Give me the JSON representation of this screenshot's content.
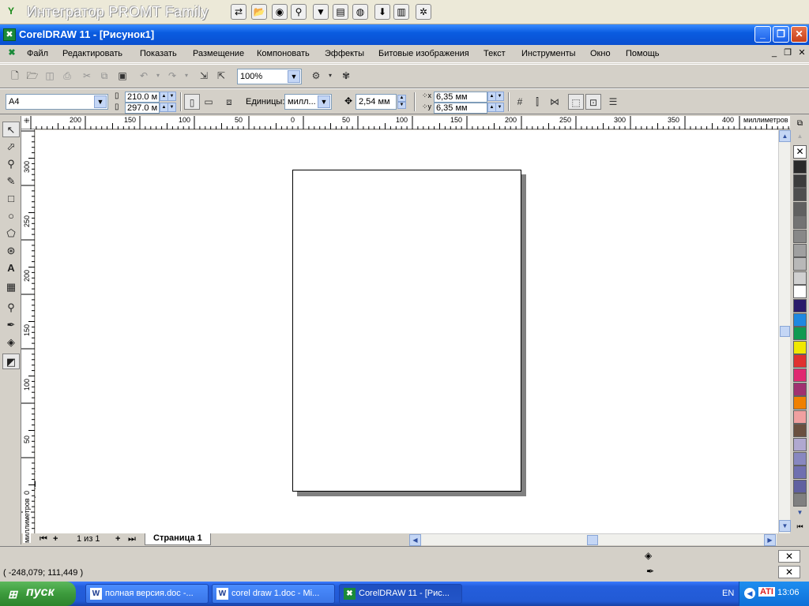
{
  "promt": {
    "title": "Интегратор PROMT Family",
    "icons": [
      "promt-logo-icon",
      "translate-icon",
      "open-folder-icon",
      "web-translate-icon",
      "dictionary-icon",
      "filter-icon",
      "book-icon",
      "globe-icon",
      "download-icon",
      "book-open-icon",
      "settings-icon"
    ]
  },
  "window": {
    "title": "CorelDRAW 11 - [Рисунок1]",
    "minimize": "_",
    "maximize": "❐",
    "close": "✕"
  },
  "menu": {
    "items": [
      "Файл",
      "Редактировать",
      "Показать",
      "Размещение",
      "Компоновать",
      "Эффекты",
      "Битовые изображения",
      "Текст",
      "Инструменты",
      "Окно",
      "Помощь"
    ]
  },
  "standard_toolbar": {
    "zoom": "100%"
  },
  "property_bar": {
    "paper_size": "A4",
    "width": "210.0 м",
    "height": "297.0 м",
    "units_label": "Единицы:",
    "units_value": "милл...",
    "nudge": "2,54 мм",
    "dup_x": "6,35 мм",
    "dup_y": "6,35 мм"
  },
  "rulers": {
    "unit_label": "миллиметров",
    "h_ticks": [
      "200",
      "150",
      "100",
      "50",
      "0",
      "50",
      "100",
      "150",
      "200",
      "250",
      "300",
      "350",
      "400"
    ],
    "v_ticks": [
      "300",
      "250",
      "200",
      "150",
      "100",
      "50",
      "0"
    ]
  },
  "page_tabs": {
    "counter": "1 из 1",
    "tab": "Страница 1"
  },
  "palette": {
    "colors": [
      "#2a2a2a",
      "#3c3c3c",
      "#4e4e4e",
      "#606060",
      "#737373",
      "#888888",
      "#a0a0a0",
      "#b8b8b8",
      "#d0d0d0",
      "#ffffff",
      "#2a1a6a",
      "#1e88e0",
      "#109a50",
      "#f0e800",
      "#e03030",
      "#e02870",
      "#a03070",
      "#f08000",
      "#f0a0a0",
      "#6a5040",
      "#b0a8d0",
      "#8888c0",
      "#7070b0",
      "#6060a0",
      "#808080"
    ]
  },
  "status": {
    "coords": "( -248,079; 111,449 )"
  },
  "taskbar": {
    "start": "пуск",
    "tasks": [
      "полная версия.doc -...",
      "corel draw 1.doc - Mi...",
      "CorelDRAW 11 - [Рис..."
    ],
    "lang": "EN",
    "time": "13:06"
  }
}
